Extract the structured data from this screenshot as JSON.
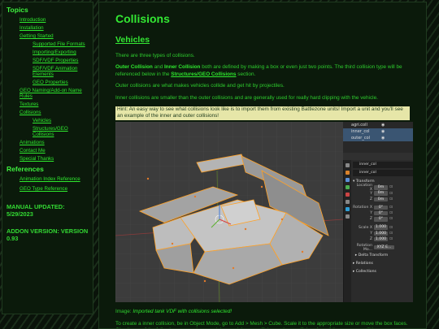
{
  "sidebar": {
    "topics_heading": "Topics",
    "topics": [
      {
        "label": "Introduction"
      },
      {
        "label": "Installation"
      },
      {
        "label": "Getting Started",
        "children": [
          "Supported File Formats",
          "Importing/Exporting",
          "SDF/VDF Properties",
          "SDF/VDF Animation Elements",
          "GEO Properties"
        ]
      },
      {
        "label": "GEO Naming/Add-on Name Rules"
      },
      {
        "label": "Textures"
      },
      {
        "label": "Collisions",
        "children": [
          "Vehicles",
          "Structures/GEO Collisions"
        ]
      },
      {
        "label": "Animations"
      },
      {
        "label": "Contact Me"
      },
      {
        "label": "Special Thanks"
      }
    ],
    "references_heading": "References",
    "references": [
      "Animation Index Reference",
      "GEO Type Reference"
    ],
    "manual_updated": "MANUAL UPDATED: 5/29/2023",
    "addon_version": "ADDON VERSION: VERSION 0.93"
  },
  "main": {
    "title": "Collisions",
    "section": "Vehicles",
    "p1": "There are three types of collisions.",
    "p2_b1": "Outer Collision",
    "p2_t1": " and ",
    "p2_b2": "Inner Collision",
    "p2_t2": " both are defined by making a box or even just two points. The third collision type will be referenced below in the ",
    "p2_link": "Structures/GEO Collisions",
    "p2_t3": " section.",
    "p3": "Outer collisions are what makes vehicles collide and get hit by projectiles.",
    "p4": "Inner collisions are smaller than the outer collisions and are generally used for really hard clipping with the vehicle.",
    "hint": "Hint: An easy way to see what collisions look like is to import them from existing Battlezone units! Import a unit and you'll see an example of the inner and outer collisions!",
    "caption_label": "Image: ",
    "caption_text": "Imported tank VDF with collisions selected!",
    "p5": "To create a inner collision, be in Object Mode, go to Add > Mesh > Cube. Scale it to the appropriate size or move the box faces. Give it one of the following names: inner_col, innercol, inner_collision, or innercollision. Any of these names will be"
  },
  "blender": {
    "outliner": [
      {
        "name": "agri.coll",
        "selected": false
      },
      {
        "name": "inner_col",
        "selected": true
      },
      {
        "name": "outer_col",
        "selected": true
      }
    ],
    "object_name": "inner_col",
    "data_name": "inner_col",
    "transform_label": "Transform",
    "location_label": "Location X",
    "location": [
      "0m",
      "0m",
      "0m"
    ],
    "rotation_label": "Rotation X",
    "rotation": [
      "0°",
      "0°",
      "0°"
    ],
    "scale_label": "Scale X",
    "scale": [
      "1.000",
      "1.000",
      "1.000"
    ],
    "rotation_mode_label": "Rotation Mo...",
    "rotation_mode": "XYZ E...",
    "y_label": "Y",
    "z_label": "Z",
    "delta_label": "Delta Transform",
    "relations_label": "Relations",
    "collections_label": "Collections"
  },
  "colors": {
    "accent": "#33e833",
    "hint_bg": "#e6e6a8",
    "panel_bg": "#0b1a0b",
    "viewport_bg": "#3c3c3c"
  }
}
